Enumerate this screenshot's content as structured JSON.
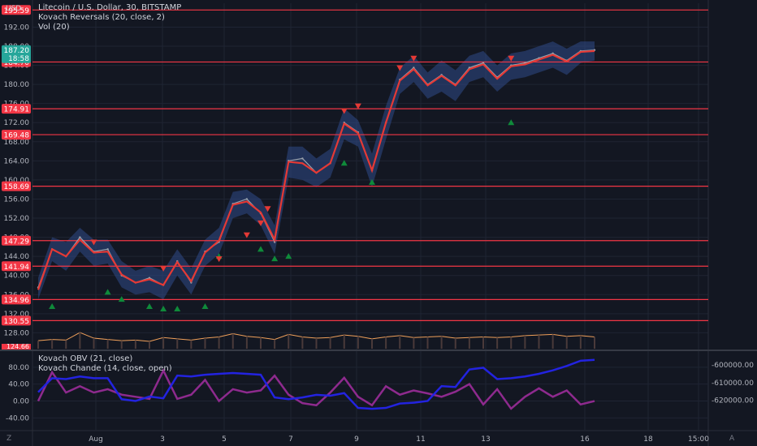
{
  "header": {
    "currency": "USD",
    "title": "Litecoin / U.S. Dollar, 30, BITSTAMP",
    "indicator_1": "Kovach Reversals (20, close, 2)",
    "indicator_2": "Vol (20)"
  },
  "lower_pane": {
    "indicator_1": "Kovach OBV (21, close)",
    "indicator_2": "Kovach Chande (14, close, open)"
  },
  "footer": {
    "left_icon": "Z",
    "right_icon": "A"
  },
  "colors": {
    "background": "#131722",
    "grid": "#1f2433",
    "candle": "#9aa1ac",
    "band": "#2f4a89",
    "basis": "#e53935",
    "level": "#f23645",
    "up_marker": "#0f8a3a",
    "down_marker": "#e53935",
    "volume": "#f0a05a",
    "obv": "#2323e0",
    "chande": "#8e2a8e",
    "last_price_bg": "#26a69a"
  },
  "chart_data": [
    {
      "type": "line",
      "name": "price",
      "yaxis_ticks": [
        "192.00",
        "188.00",
        "184.00",
        "180.00",
        "176.00",
        "172.00",
        "168.00",
        "164.00",
        "160.00",
        "156.00",
        "152.00",
        "148.00",
        "144.00",
        "140.00",
        "136.00",
        "132.00",
        "128.00"
      ],
      "ylim": [
        124.5,
        197.0
      ],
      "xaxis_ticks": [
        "Aug",
        "3",
        "5",
        "7",
        "9",
        "11",
        "13",
        "16",
        "18",
        "15:00"
      ],
      "horizontal_levels": [
        "195.59",
        "184.70",
        "174.91",
        "169.48",
        "158.69",
        "147.29",
        "141.94",
        "134.96",
        "130.55"
      ],
      "last_price": "187.20",
      "countdown": "18:58",
      "bottom_clip_label": "124.66",
      "x": [
        0,
        1,
        2,
        3,
        4,
        5,
        6,
        7,
        8,
        9,
        10,
        11,
        12,
        13,
        14,
        15,
        16,
        17,
        18,
        19,
        20,
        21,
        22,
        23,
        24,
        25,
        26,
        27,
        28,
        29,
        30,
        31,
        32,
        33,
        34,
        35,
        36,
        37,
        38,
        39,
        40
      ],
      "close": [
        137.5,
        145.5,
        144.0,
        148.0,
        145.0,
        145.5,
        140.0,
        138.5,
        139.5,
        138.0,
        143.0,
        138.5,
        145.0,
        147.0,
        155.0,
        156.0,
        153.0,
        147.0,
        164.0,
        164.5,
        161.5,
        163.5,
        172.0,
        170.0,
        162.0,
        172.0,
        181.0,
        183.5,
        180.0,
        182.0,
        180.0,
        183.5,
        184.5,
        181.5,
        184.0,
        184.5,
        185.5,
        186.5,
        185.0,
        187.0,
        187.2
      ],
      "upper_band": [
        139.5,
        148.0,
        147.0,
        150.0,
        147.5,
        147.5,
        143.0,
        141.0,
        142.0,
        141.0,
        145.5,
        141.5,
        147.5,
        150.0,
        157.5,
        158.0,
        156.0,
        150.5,
        167.0,
        167.0,
        164.5,
        166.5,
        175.0,
        172.5,
        165.5,
        175.5,
        183.5,
        186.0,
        182.5,
        185.0,
        183.0,
        186.0,
        187.0,
        184.0,
        186.5,
        187.0,
        188.0,
        189.0,
        187.5,
        189.0,
        189.0
      ],
      "lower_band": [
        135.0,
        143.0,
        141.0,
        145.0,
        142.0,
        142.5,
        137.5,
        136.0,
        136.5,
        135.0,
        140.0,
        136.0,
        142.0,
        144.5,
        152.0,
        153.0,
        150.5,
        144.5,
        160.5,
        160.0,
        158.5,
        160.5,
        168.5,
        167.0,
        158.5,
        168.5,
        178.0,
        180.5,
        177.0,
        178.5,
        176.5,
        180.5,
        181.5,
        178.5,
        181.0,
        181.5,
        182.5,
        183.5,
        182.0,
        184.5,
        185.0
      ],
      "basis": [
        137.0,
        145.5,
        144.0,
        147.5,
        144.8,
        145.0,
        140.2,
        138.5,
        139.2,
        138.0,
        142.8,
        138.8,
        144.8,
        147.3,
        154.8,
        155.5,
        153.2,
        147.5,
        163.8,
        163.5,
        161.5,
        163.5,
        171.8,
        169.8,
        162.0,
        172.0,
        180.8,
        183.2,
        179.8,
        181.8,
        179.8,
        183.2,
        184.2,
        181.2,
        183.8,
        184.2,
        185.2,
        186.2,
        184.8,
        186.8,
        187.0
      ],
      "volume": [
        1.0,
        1.2,
        1.1,
        2.3,
        1.4,
        1.2,
        1.0,
        1.1,
        0.9,
        1.5,
        1.3,
        1.1,
        1.4,
        1.6,
        2.1,
        1.7,
        1.5,
        1.2,
        2.0,
        1.6,
        1.4,
        1.5,
        1.9,
        1.7,
        1.3,
        1.6,
        1.8,
        1.5,
        1.6,
        1.7,
        1.4,
        1.5,
        1.6,
        1.5,
        1.6,
        1.8,
        1.9,
        2.0,
        1.7,
        1.8,
        1.6
      ],
      "up_markers": [
        [
          1,
          133.5
        ],
        [
          5,
          136.5
        ],
        [
          6,
          135.0
        ],
        [
          8,
          133.5
        ],
        [
          9,
          133.0
        ],
        [
          10,
          133.0
        ],
        [
          12,
          133.5
        ],
        [
          13,
          144.0
        ],
        [
          16,
          145.5
        ],
        [
          17,
          143.5
        ],
        [
          18,
          144.0
        ],
        [
          22,
          163.5
        ],
        [
          24,
          159.5
        ],
        [
          34,
          172.0
        ]
      ],
      "down_markers": [
        [
          4,
          147.0
        ],
        [
          9,
          141.5
        ],
        [
          13,
          143.5
        ],
        [
          15,
          148.5
        ],
        [
          16,
          151.0
        ],
        [
          16.5,
          154.0
        ],
        [
          22,
          174.5
        ],
        [
          23,
          175.5
        ],
        [
          26,
          183.5
        ],
        [
          27,
          185.5
        ],
        [
          34,
          185.5
        ]
      ]
    },
    {
      "type": "line",
      "name": "oscillators",
      "yaxis_ticks_left": [
        "80.00",
        "40.00",
        "0.00",
        "-40.00"
      ],
      "ylim_left": [
        -68,
        118
      ],
      "yaxis_ticks_right": [
        "-600000.00",
        "-610000.00",
        "-620000.00"
      ],
      "ylim_right": [
        -637000,
        -592000
      ],
      "x": [
        0,
        1,
        2,
        3,
        4,
        5,
        6,
        7,
        8,
        9,
        10,
        11,
        12,
        13,
        14,
        15,
        16,
        17,
        18,
        19,
        20,
        21,
        22,
        23,
        24,
        25,
        26,
        27,
        28,
        29,
        30,
        31,
        32,
        33,
        34,
        35,
        36,
        37,
        38,
        39,
        40
      ],
      "obv": [
        -615500,
        -607500,
        -608000,
        -606500,
        -607500,
        -607500,
        -619500,
        -620500,
        -618000,
        -619000,
        -606000,
        -606500,
        -605500,
        -605000,
        -604500,
        -605000,
        -605500,
        -618500,
        -619500,
        -618500,
        -617000,
        -617500,
        -616000,
        -624500,
        -625000,
        -624500,
        -622000,
        -621500,
        -620500,
        -612000,
        -612500,
        -602500,
        -601500,
        -608000,
        -607500,
        -606500,
        -605000,
        -603000,
        -600500,
        -597500,
        -597000
      ],
      "chande": [
        0,
        68,
        20,
        35,
        20,
        28,
        15,
        10,
        5,
        72,
        5,
        15,
        50,
        0,
        28,
        20,
        25,
        60,
        15,
        -5,
        -10,
        20,
        55,
        10,
        -10,
        35,
        15,
        25,
        18,
        10,
        22,
        40,
        -8,
        28,
        -18,
        10,
        30,
        10,
        25,
        -8,
        0
      ]
    }
  ]
}
